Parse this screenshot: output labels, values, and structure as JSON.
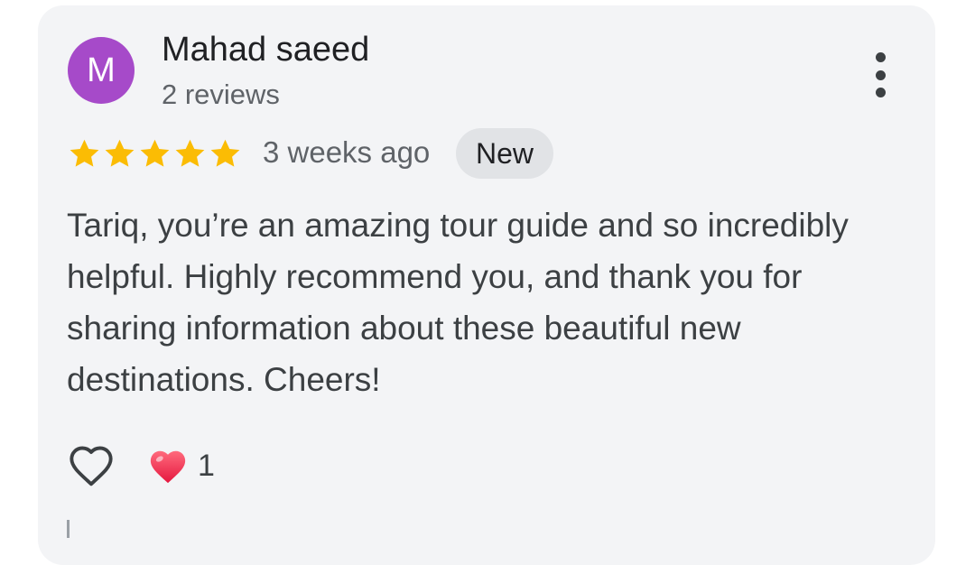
{
  "review": {
    "avatar_initial": "M",
    "avatar_color": "#a64ac9",
    "author_name": "Mahad saeed",
    "author_reviews": "2 reviews",
    "rating": 5,
    "rating_max": 5,
    "star_color": "#fbbc04",
    "time_ago": "3 weeks ago",
    "badge": "New",
    "text": "Tariq, you’re an amazing tour guide and so incredibly helpful. Highly recommend you, and thank you for sharing information about these beautiful new destinations. Cheers!",
    "more_icon": "more-vert-icon",
    "like_icon": "heart-outline-icon",
    "reaction_icon": "heart-emoji-icon",
    "reaction_count": "1"
  }
}
